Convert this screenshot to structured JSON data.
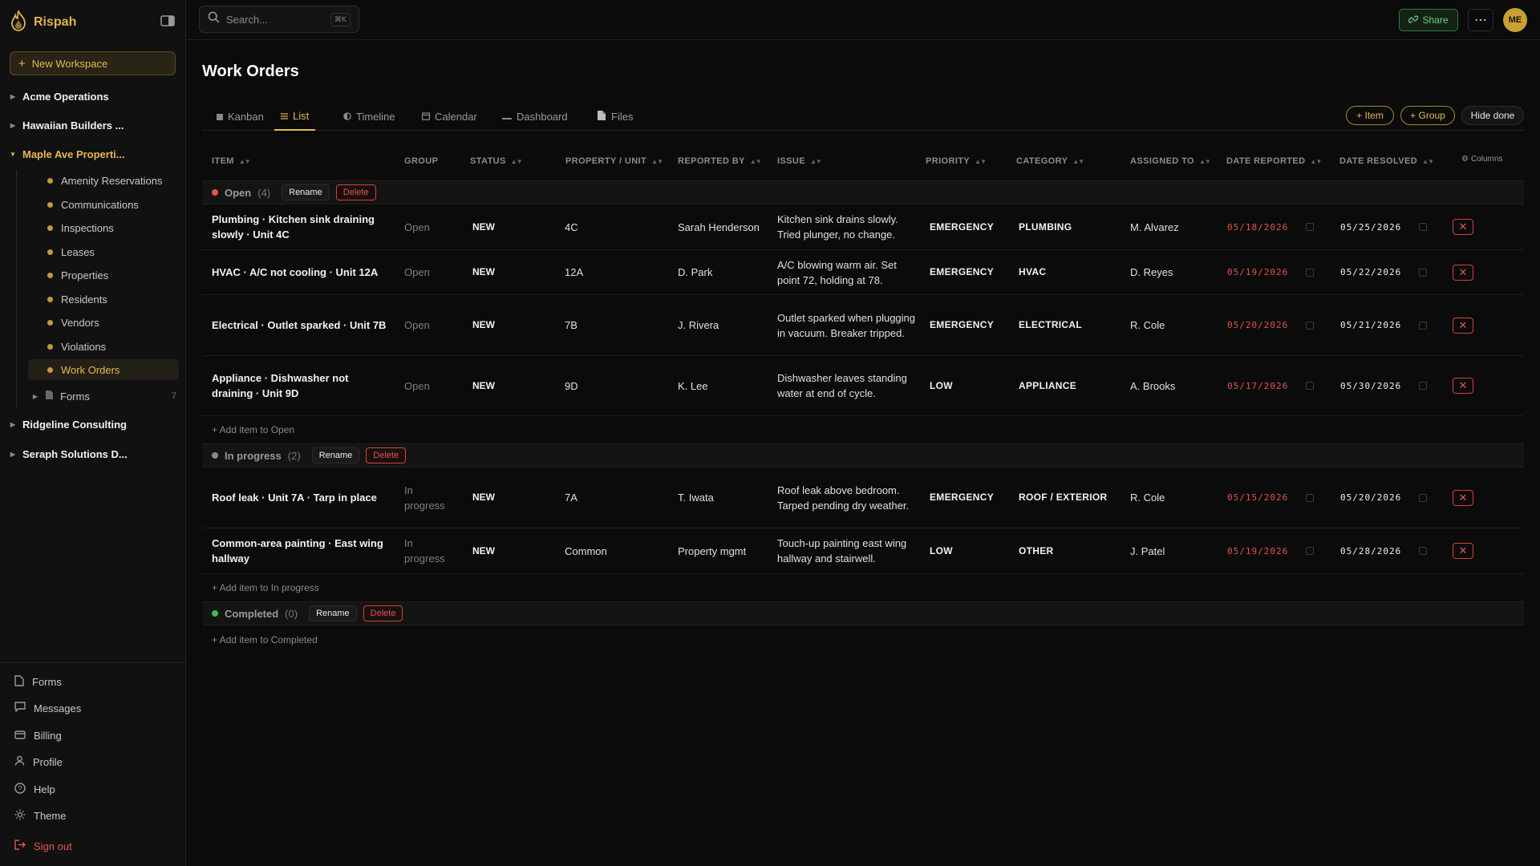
{
  "brand": {
    "name": "Rispah",
    "color": "#e2b24c"
  },
  "sidebar": {
    "new_workspace": "New Workspace",
    "workspaces": [
      {
        "label": "Acme Operations",
        "expanded": false
      },
      {
        "label": "Hawaiian Builders ...",
        "expanded": false
      },
      {
        "label": "Maple Ave Properti...",
        "expanded": true
      },
      {
        "label": "Ridgeline Consulting",
        "expanded": false
      },
      {
        "label": "Seraph Solutions D...",
        "expanded": false
      }
    ],
    "boards": [
      {
        "label": "Amenity Reservations"
      },
      {
        "label": "Communications"
      },
      {
        "label": "Inspections"
      },
      {
        "label": "Leases"
      },
      {
        "label": "Properties"
      },
      {
        "label": "Residents"
      },
      {
        "label": "Vendors"
      },
      {
        "label": "Violations"
      },
      {
        "label": "Work Orders",
        "active": true
      }
    ],
    "forms": {
      "label": "Forms",
      "count": "7"
    },
    "bottom": [
      {
        "label": "Forms",
        "icon": "file-icon"
      },
      {
        "label": "Messages",
        "icon": "message-icon"
      },
      {
        "label": "Billing",
        "icon": "card-icon"
      },
      {
        "label": "Profile",
        "icon": "user-icon"
      },
      {
        "label": "Help",
        "icon": "help-icon"
      },
      {
        "label": "Theme",
        "icon": "sun-icon"
      },
      {
        "label": "Sign out",
        "icon": "signout-icon"
      }
    ]
  },
  "topbar": {
    "search_placeholder": "Search...",
    "shortcut": "⌘K",
    "share": "Share",
    "more": "⋯",
    "avatar": "ME"
  },
  "page": {
    "title": "Work Orders"
  },
  "tabs": [
    {
      "label": "Kanban",
      "icon": "kanban-icon"
    },
    {
      "label": "List",
      "icon": "list-icon",
      "active": true
    },
    {
      "label": "Timeline",
      "icon": "timeline-icon"
    },
    {
      "label": "Calendar",
      "icon": "calendar-icon"
    },
    {
      "label": "Dashboard",
      "icon": "dashboard-icon"
    },
    {
      "label": "Files",
      "icon": "file-icon"
    }
  ],
  "actions": {
    "add_item": "+ Item",
    "add_group": "+ Group",
    "hide_done": "Hide done"
  },
  "columns": {
    "headers": [
      "ITEM",
      "GROUP",
      "STATUS",
      "PROPERTY / UNIT",
      "REPORTED BY",
      "ISSUE",
      "PRIORITY",
      "CATEGORY",
      "ASSIGNED TO",
      "DATE REPORTED",
      "DATE RESOLVED"
    ],
    "columns_btn": "Columns"
  },
  "group_actions": {
    "rename": "Rename",
    "delete": "Delete"
  },
  "groups": [
    {
      "name": "Open",
      "count": "(4)",
      "color": "#e0564e",
      "add_label": "+ Add item to Open",
      "rows": [
        {
          "item": "Plumbing · Kitchen sink draining slowly · Unit 4C",
          "group": "Open",
          "status": "NEW",
          "unit": "4C",
          "reported_by": "Sarah Henderson",
          "issue": "Kitchen sink drains slowly. Tried plunger, no change.",
          "priority": "EMERGENCY",
          "category": "PLUMBING",
          "assigned": "M. Alvarez",
          "date_reported": "05/18/2026",
          "date_resolved": "05/25/2026"
        },
        {
          "item": "HVAC · A/C not cooling · Unit 12A",
          "group": "Open",
          "status": "NEW",
          "unit": "12A",
          "reported_by": "D. Park",
          "issue": "A/C blowing warm air. Set point 72, holding at 78.",
          "priority": "EMERGENCY",
          "category": "HVAC",
          "assigned": "D. Reyes",
          "date_reported": "05/19/2026",
          "date_resolved": "05/22/2026"
        },
        {
          "item": "Electrical · Outlet sparked · Unit 7B",
          "group": "Open",
          "status": "NEW",
          "unit": "7B",
          "reported_by": "J. Rivera",
          "issue": "Outlet sparked when plugging in vacuum. Breaker tripped.",
          "priority": "EMERGENCY",
          "category": "ELECTRICAL",
          "assigned": "R. Cole",
          "date_reported": "05/20/2026",
          "date_resolved": "05/21/2026"
        },
        {
          "item": "Appliance · Dishwasher not draining · Unit 9D",
          "group": "Open",
          "status": "NEW",
          "unit": "9D",
          "reported_by": "K. Lee",
          "issue": "Dishwasher leaves standing water at end of cycle.",
          "priority": "LOW",
          "category": "APPLIANCE",
          "assigned": "A. Brooks",
          "date_reported": "05/17/2026",
          "date_resolved": "05/30/2026"
        }
      ]
    },
    {
      "name": "In progress",
      "count": "(2)",
      "color": "#8a8a8a",
      "add_label": "+ Add item to In progress",
      "rows": [
        {
          "item": "Roof leak · Unit 7A · Tarp in place",
          "group": "In progress",
          "status": "NEW",
          "unit": "7A",
          "reported_by": "T. Iwata",
          "issue": "Roof leak above bedroom. Tarped pending dry weather.",
          "priority": "EMERGENCY",
          "category": "ROOF / EXTERIOR",
          "assigned": "R. Cole",
          "date_reported": "05/15/2026",
          "date_resolved": "05/20/2026"
        },
        {
          "item": "Common-area painting · East wing hallway",
          "group": "In progress",
          "status": "NEW",
          "unit": "Common",
          "reported_by": "Property mgmt",
          "issue": "Touch-up painting east wing hallway and stairwell.",
          "priority": "LOW",
          "category": "OTHER",
          "assigned": "J. Patel",
          "date_reported": "05/19/2026",
          "date_resolved": "05/28/2026"
        }
      ]
    },
    {
      "name": "Completed",
      "count": "(0)",
      "color": "#3fb950",
      "add_label": "+ Add item to Completed",
      "rows": []
    }
  ]
}
